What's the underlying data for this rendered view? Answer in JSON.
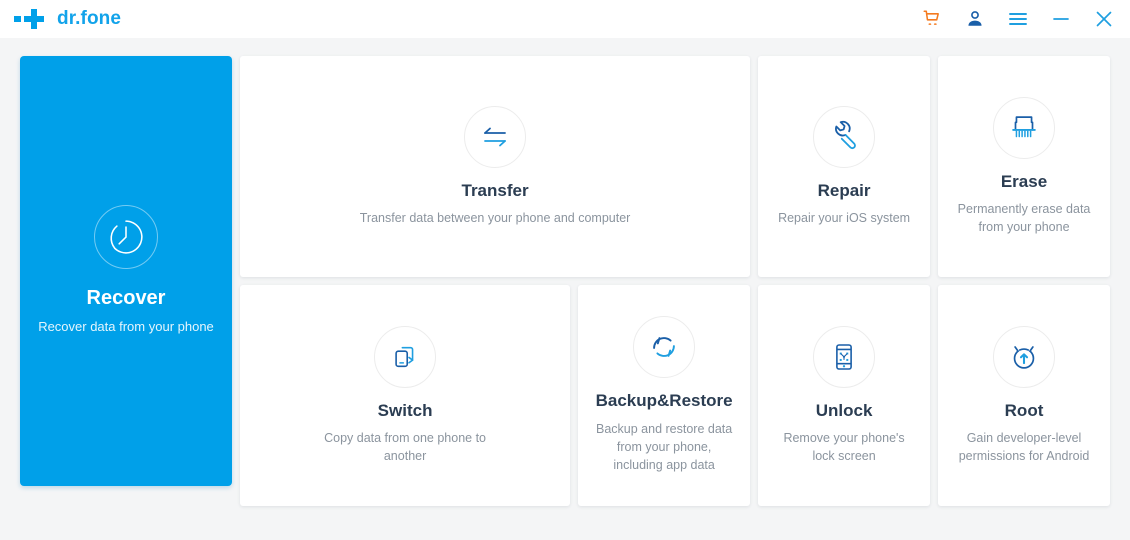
{
  "app": {
    "brand_name": "dr.fone",
    "logo_icon": "drfone-cross-logo",
    "accent_color": "#00a0e9",
    "cart_color": "#f47b20",
    "background_color": "#f4f5f6"
  },
  "titlebar": {
    "actions": [
      {
        "name": "cart-icon",
        "label": "Shopping cart",
        "color": "#f47b20"
      },
      {
        "name": "account-icon",
        "label": "Account",
        "color": "#1a5fa8"
      },
      {
        "name": "menu-icon",
        "label": "Menu",
        "color": "#1f9fe0"
      },
      {
        "name": "minimize-icon",
        "label": "Minimize",
        "color": "#1f9fe0"
      },
      {
        "name": "close-icon",
        "label": "Close",
        "color": "#1f9fe0"
      }
    ]
  },
  "featured": {
    "icon": "recover-clock-icon",
    "title": "Recover",
    "desc": "Recover data from your phone"
  },
  "modules": [
    {
      "icon": "transfer-arrows-icon",
      "title": "Transfer",
      "desc": "Transfer data between your phone and computer"
    },
    {
      "icon": "repair-wrench-icon",
      "title": "Repair",
      "desc": "Repair your iOS system"
    },
    {
      "icon": "erase-shredder-icon",
      "title": "Erase",
      "desc": "Permanently erase data from your phone"
    },
    {
      "icon": "switch-phones-icon",
      "title": "Switch",
      "desc": "Copy data from one phone to another"
    },
    {
      "icon": "backup-restore-icon",
      "title": "Backup&Restore",
      "desc": "Backup and restore data from your phone, including app data"
    },
    {
      "icon": "unlock-phone-icon",
      "title": "Unlock",
      "desc": "Remove your phone's lock screen"
    },
    {
      "icon": "root-android-icon",
      "title": "Root",
      "desc": "Gain developer-level permissions for Android"
    }
  ]
}
